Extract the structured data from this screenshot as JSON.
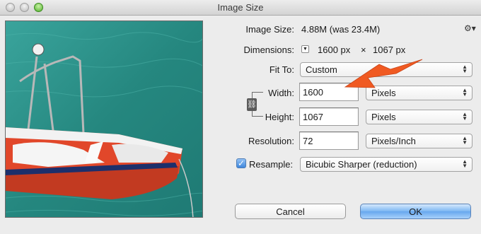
{
  "window": {
    "title": "Image Size"
  },
  "info": {
    "image_size_label": "Image Size:",
    "image_size_value": "4.88M (was 23.4M)",
    "dimensions_label": "Dimensions:",
    "dimensions_width": "1600 px",
    "dimensions_times": "×",
    "dimensions_height": "1067 px"
  },
  "fit_to": {
    "label": "Fit To:",
    "value": "Custom"
  },
  "width": {
    "label": "Width:",
    "value": "1600",
    "unit": "Pixels"
  },
  "height": {
    "label": "Height:",
    "value": "1067",
    "unit": "Pixels"
  },
  "resolution": {
    "label": "Resolution:",
    "value": "72",
    "unit": "Pixels/Inch"
  },
  "resample": {
    "label": "Resample:",
    "checked": true,
    "value": "Bicubic Sharper (reduction)"
  },
  "buttons": {
    "cancel": "Cancel",
    "ok": "OK"
  },
  "icons": {
    "gear": "gear-icon",
    "chain": "chain-link-icon",
    "check": "checkmark-icon"
  },
  "colors": {
    "annotation_arrow": "#f05a22",
    "ok_button": "#6aa9ef",
    "water": "#2a8f88",
    "boat_hull": "#e1472a"
  }
}
